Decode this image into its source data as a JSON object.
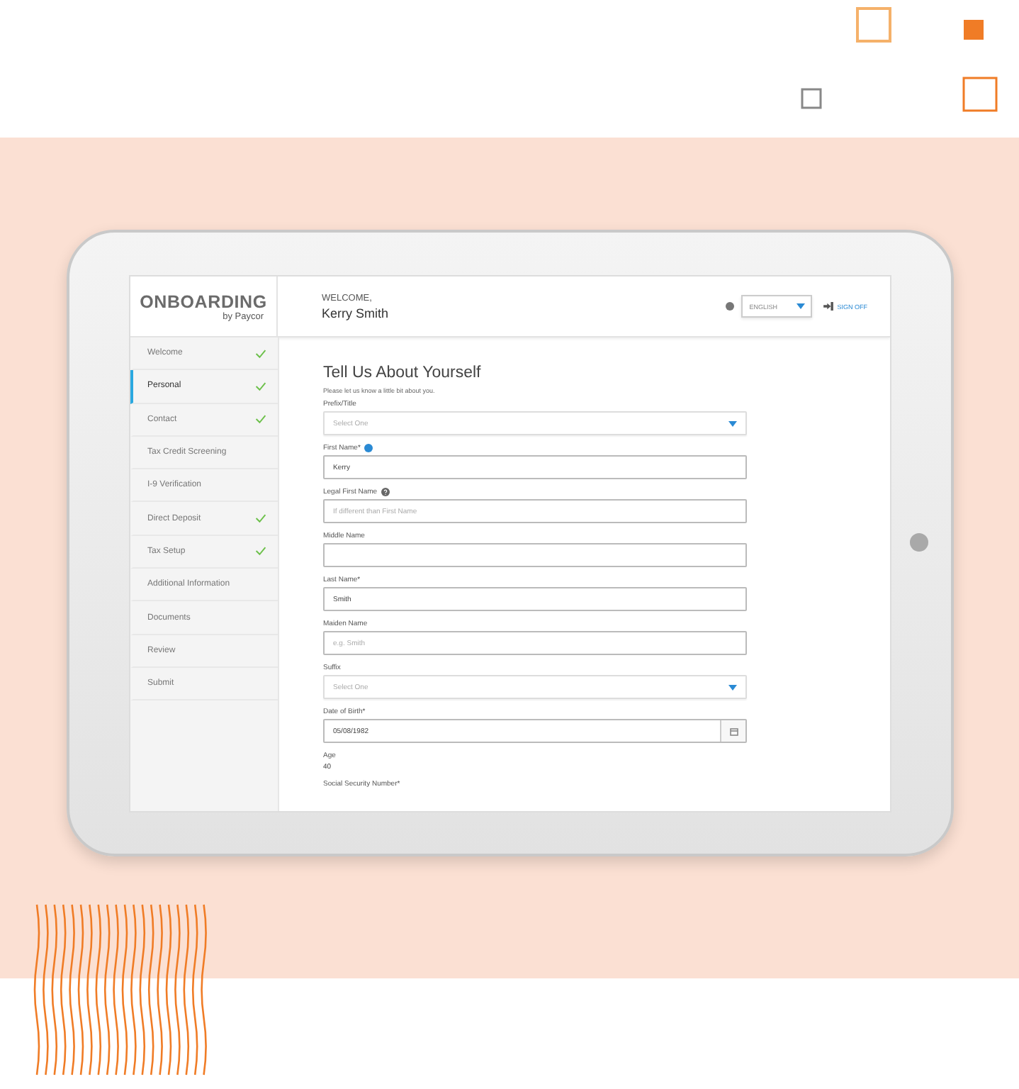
{
  "header": {
    "logo": "ONBOARDING",
    "logo_byline": "by Paycor",
    "greeting": "WELCOME,",
    "user_name": "Kerry Smith",
    "language": "ENGLISH",
    "sign_off": "SIGN OFF"
  },
  "sidebar": {
    "items": [
      {
        "label": "Welcome",
        "checked": true,
        "selected": false
      },
      {
        "label": "Personal",
        "checked": true,
        "selected": true
      },
      {
        "label": "Contact",
        "checked": true,
        "selected": false
      },
      {
        "label": "Tax Credit Screening",
        "checked": false,
        "selected": false
      },
      {
        "label": "I-9 Verification",
        "checked": false,
        "selected": false
      },
      {
        "label": "Direct Deposit",
        "checked": true,
        "selected": false
      },
      {
        "label": "Tax Setup",
        "checked": true,
        "selected": false
      },
      {
        "label": "Additional Information",
        "checked": false,
        "selected": false
      },
      {
        "label": "Documents",
        "checked": false,
        "selected": false
      },
      {
        "label": "Review",
        "checked": false,
        "selected": false
      },
      {
        "label": "Submit",
        "checked": false,
        "selected": false
      }
    ]
  },
  "form": {
    "title": "Tell Us About Yourself",
    "subtitle": "Please let us know a little bit about you.",
    "fields": [
      {
        "kind": "select",
        "label": "Prefix/Title",
        "placeholder": "Select One"
      },
      {
        "kind": "text",
        "label": "First Name*",
        "value": "Kerry",
        "info_icon": true
      },
      {
        "kind": "text",
        "label": "Legal First Name",
        "placeholder": "If different than First Name",
        "help_icon": true
      },
      {
        "kind": "text",
        "label": "Middle Name"
      },
      {
        "kind": "text",
        "label": "Last Name*",
        "value": "Smith"
      },
      {
        "kind": "text",
        "label": "Maiden Name",
        "placeholder": "e.g. Smith"
      },
      {
        "kind": "select",
        "label": "Suffix",
        "placeholder": "Select One"
      },
      {
        "kind": "date",
        "label": "Date of Birth*",
        "value": "05/08/1982"
      },
      {
        "kind": "static",
        "label": "Age",
        "value": "40"
      },
      {
        "kind": "heading",
        "label": "Social Security Number*"
      }
    ]
  }
}
